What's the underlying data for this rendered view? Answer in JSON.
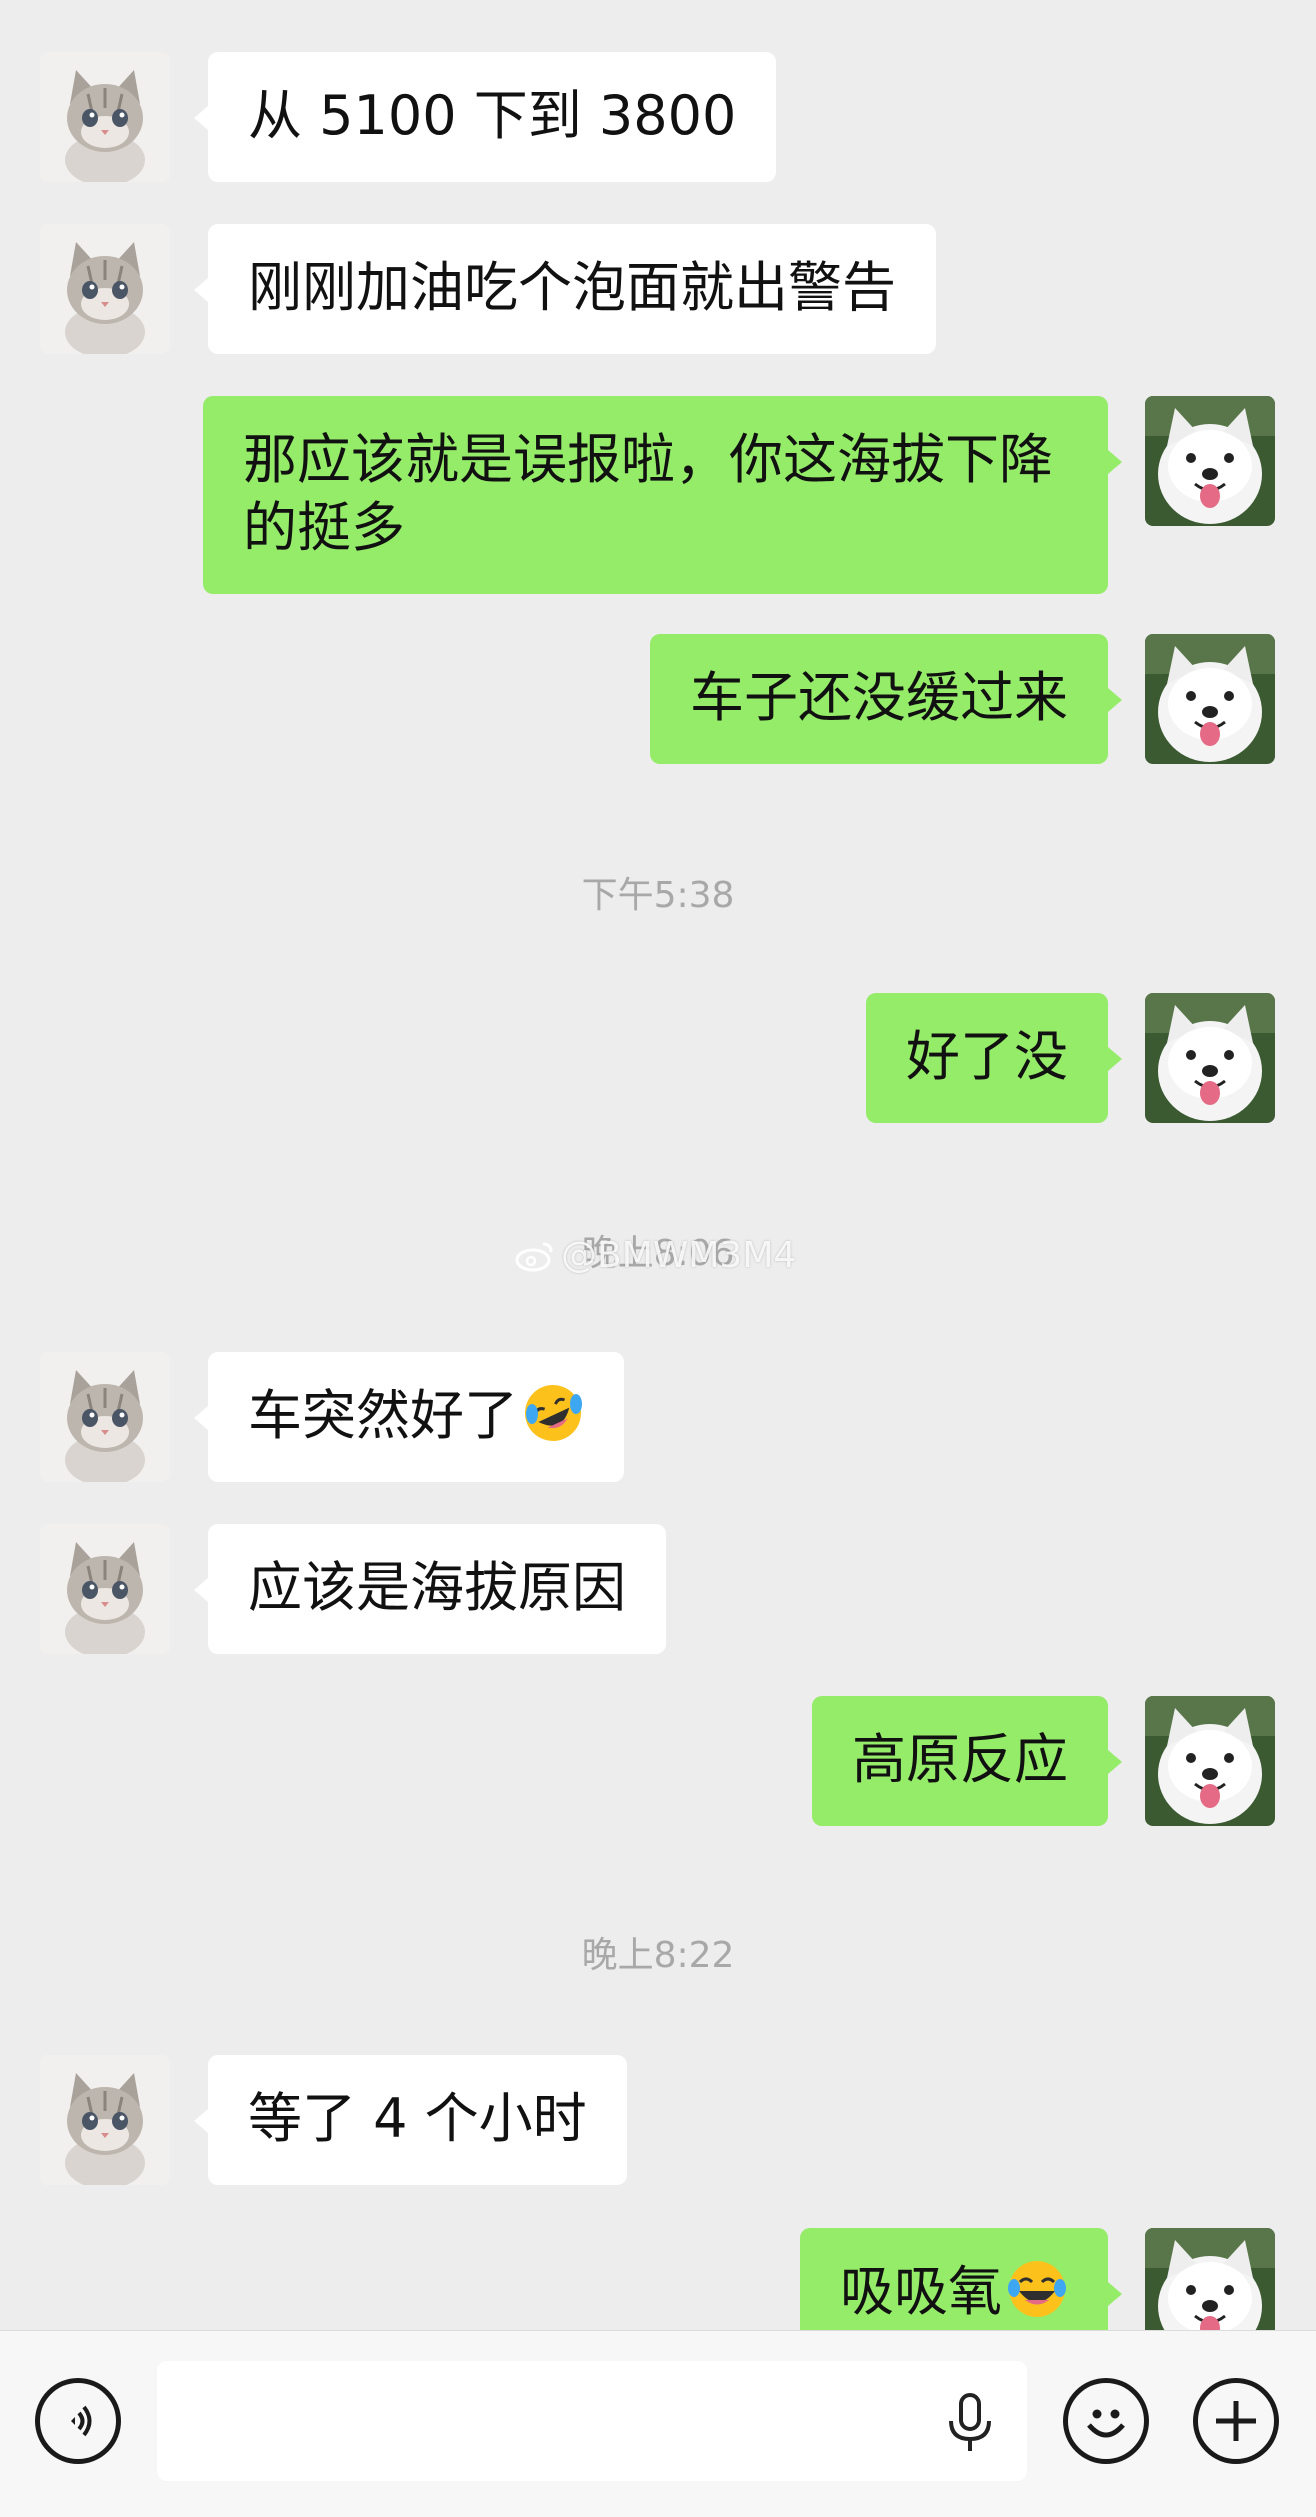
{
  "chat": {
    "messages": [
      {
        "side": "in",
        "text": "从 5100 下到 3800",
        "emoji": ""
      },
      {
        "side": "in",
        "text": "刚刚加油吃个泡面就出警告",
        "emoji": ""
      },
      {
        "side": "out",
        "text": "那应该就是误报啦，你这海拔下降的挺多",
        "emoji": ""
      },
      {
        "side": "out",
        "text": "车子还没缓过来",
        "emoji": ""
      },
      {
        "side": "out",
        "text": "好了没",
        "emoji": ""
      },
      {
        "side": "in",
        "text": "车突然好了",
        "emoji": "rolling-on-floor-laughing-emoji"
      },
      {
        "side": "in",
        "text": "应该是海拔原因",
        "emoji": ""
      },
      {
        "side": "out",
        "text": "高原反应",
        "emoji": ""
      },
      {
        "side": "in",
        "text": "等了 4 个小时",
        "emoji": ""
      },
      {
        "side": "out",
        "text": "吸吸氧",
        "emoji": "face-with-tears-of-joy-emoji"
      }
    ],
    "timestamps": [
      "下午5:38",
      "晚上8:06",
      "晚上8:22"
    ],
    "watermark": "@BMWM3M4"
  },
  "avatars": {
    "incoming": "kitten-avatar",
    "outgoing": "samoyed-avatar"
  },
  "input_bar": {
    "text_value": "",
    "icons": [
      "voice-icon",
      "microphone-icon",
      "emoji-icon",
      "plus-icon"
    ]
  },
  "colors": {
    "background": "#ededed",
    "outgoing_bubble": "#95ec69",
    "incoming_bubble": "#ffffff",
    "timestamp_text": "#a8a8a8"
  }
}
